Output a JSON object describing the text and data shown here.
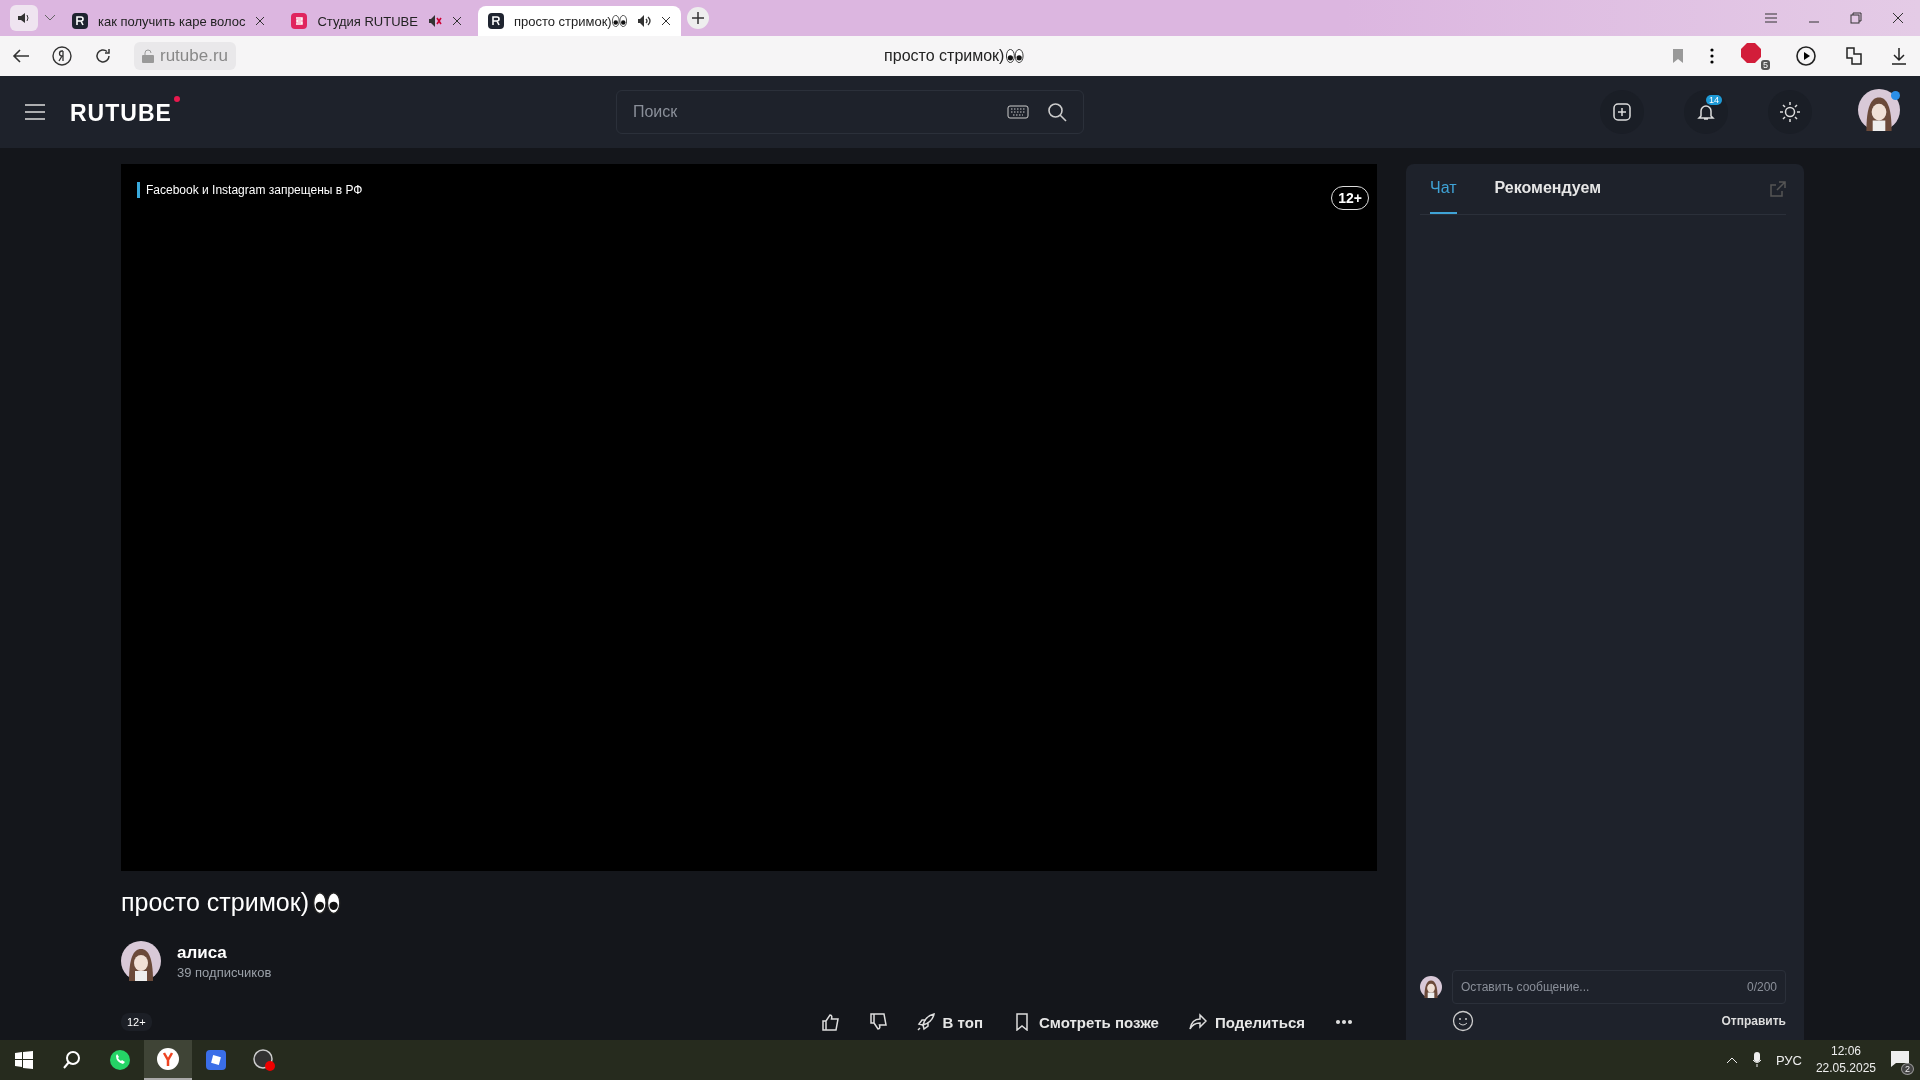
{
  "browser": {
    "tabs": [
      {
        "title": "как получить каре волос",
        "sound": false,
        "selected": false
      },
      {
        "title": "Студия RUTUBE",
        "sound": true,
        "muted": true,
        "selected": false
      },
      {
        "title": "просто стримок)",
        "sound": true,
        "muted": false,
        "selected": true
      }
    ],
    "address": "rutube.ru",
    "page_title": "просто стримок)",
    "adblock_count": "5"
  },
  "header": {
    "logo": "RUTUBE",
    "search": {
      "placeholder": "Поиск"
    },
    "notifications_count": "14"
  },
  "player": {
    "notice": "Facebook и Instagram запрещены в РФ",
    "age_rating": "12+"
  },
  "video": {
    "title": "просто стримок)",
    "channel": {
      "name": "алиса",
      "subscribers": "39 подписчиков"
    },
    "age_rating": "12+",
    "actions": [
      {
        "kind": "like"
      },
      {
        "kind": "dislike"
      },
      {
        "kind": "top",
        "label": "В топ"
      },
      {
        "kind": "later",
        "label": "Смотреть позже"
      },
      {
        "kind": "share",
        "label": "Поделиться"
      },
      {
        "kind": "more"
      }
    ]
  },
  "side_panel": {
    "tabs": [
      {
        "label": "Чат",
        "selected": true
      },
      {
        "label": "Рекомендуем",
        "selected": false
      }
    ],
    "message": {
      "placeholder": "Оставить сообщение...",
      "counter": "0/200"
    },
    "send": "Отправить"
  },
  "taskbar": {
    "language": "РУС",
    "time": "12:06",
    "date": "22.05.2025",
    "notifications_count": "2"
  }
}
